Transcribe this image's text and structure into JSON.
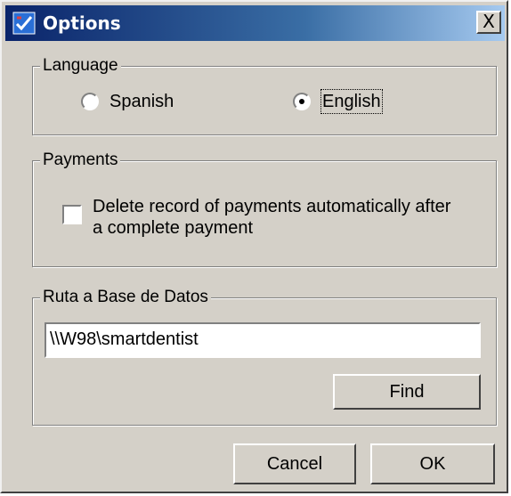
{
  "window": {
    "title": "Options",
    "close_label": "X"
  },
  "language": {
    "legend": "Language",
    "options": [
      {
        "label": "Spanish",
        "selected": false
      },
      {
        "label": "English",
        "selected": true
      }
    ]
  },
  "payments": {
    "legend": "Payments",
    "delete_after_complete": {
      "label_line1": "Delete record of payments automatically after",
      "label_line2": "a complete payment",
      "checked": false
    }
  },
  "database": {
    "legend": "Ruta a Base de Datos",
    "path_value": "\\\\W98\\smartdentist",
    "find_label": "Find"
  },
  "footer": {
    "cancel_label": "Cancel",
    "ok_label": "OK"
  }
}
